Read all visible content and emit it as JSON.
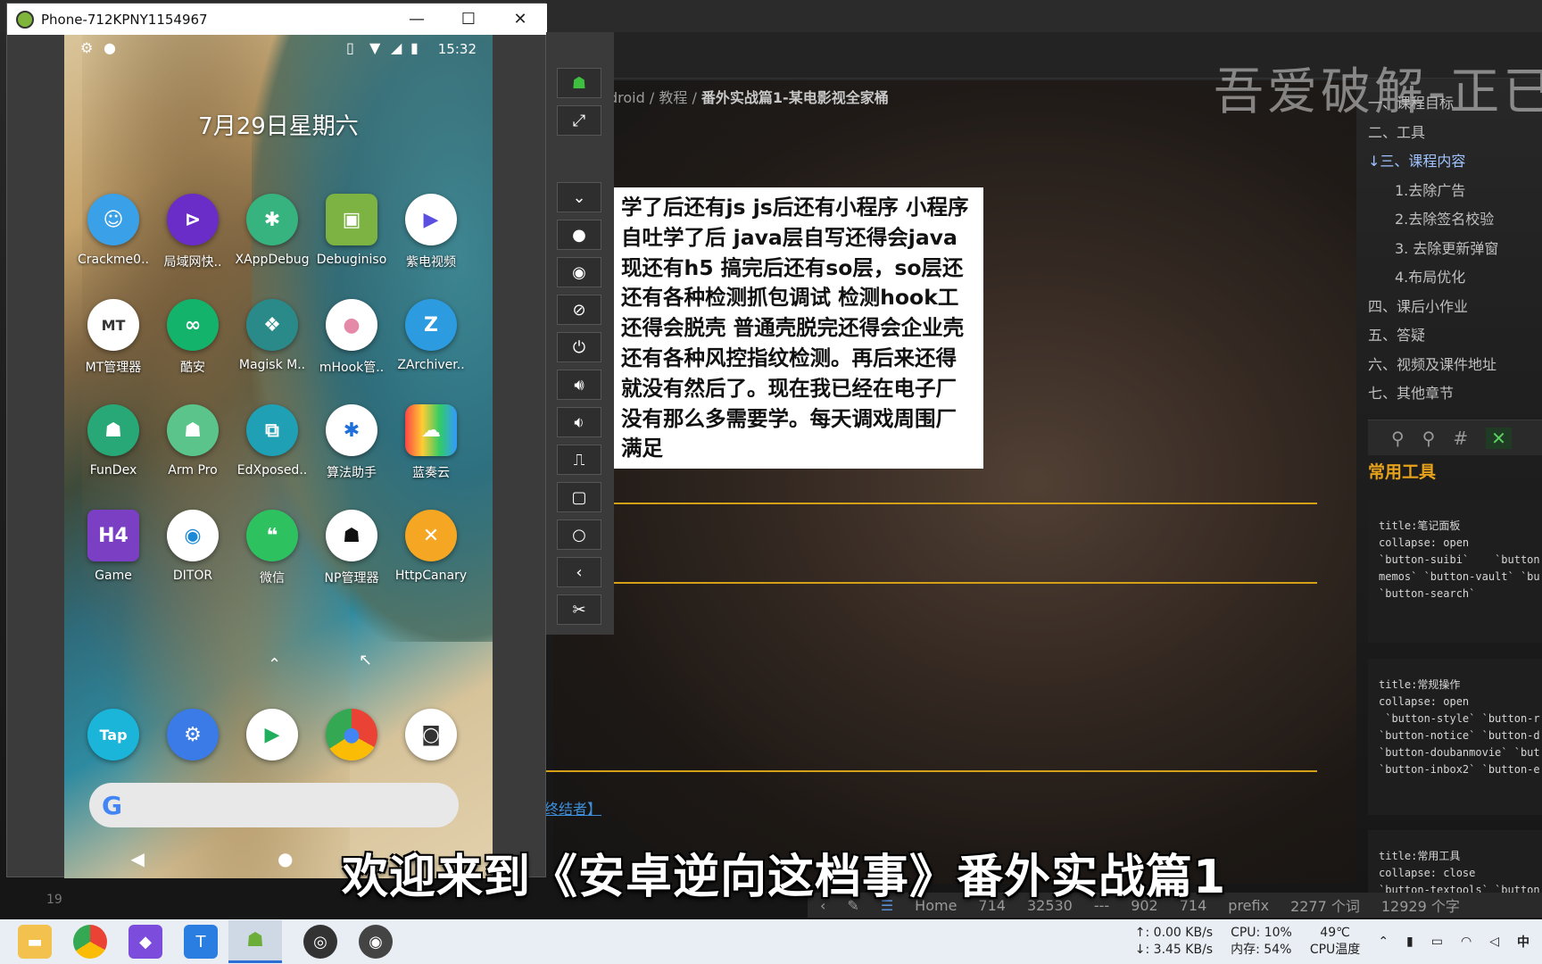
{
  "window": {
    "title": "Phone-712KPNY1154967"
  },
  "phone": {
    "time": "15:32",
    "date": "7月29日星期六",
    "apps_row1": [
      "Crackme0..",
      "局域网快..",
      "XAppDebug",
      "Debuginiso",
      "紫电视频"
    ],
    "apps_row2": [
      "MT管理器",
      "酷安",
      "Magisk M..",
      "mHook管..",
      "ZArchiver.."
    ],
    "apps_row3": [
      "FunDex",
      "Arm Pro",
      "EdXposed..",
      "算法助手",
      "蓝奏云"
    ],
    "apps_row4": [
      "Game",
      "DITOR",
      "微信",
      "NP管理器",
      "HttpCanary"
    ],
    "dock": [
      "tap-icon",
      "settings-icon",
      "play-store-icon",
      "chrome-icon",
      "camera-icon"
    ],
    "search_glyph": "G"
  },
  "editor": {
    "breadcrumb_1": "droid",
    "breadcrumb_2": "教程",
    "breadcrumb_current": "番外实战篇1-某电影视全家桶",
    "watermark": "吾爱破解-正已",
    "note_lines": [
      "学了后还有js js后还有小程序 小程序",
      "自吐学了后 java层自写还得会java",
      "现还有h5 搞完后还有so层，so层还",
      "还有各种检测抓包调试 检测hook工",
      "还得会脱壳 普通壳脱完还得会企业壳",
      "还有各种风控指纹检测。再后来还得",
      "就没有然后了。现在我已经在电子厂",
      "没有那么多需要学。每天调戏周围厂",
      "满足"
    ],
    "link_text": "终结者】",
    "line_number": "19",
    "subtitle": "欢迎来到《安卓逆向这档事》番外实战篇1"
  },
  "toc": [
    {
      "label": "一、课程目标",
      "level": 0
    },
    {
      "label": "二、工具",
      "level": 0
    },
    {
      "label": "三、课程内容",
      "level": 0,
      "current": true
    },
    {
      "label": "1.去除广告",
      "level": 1
    },
    {
      "label": "2.去除签名校验",
      "level": 1
    },
    {
      "label": "3. 去除更新弹窗",
      "level": 1
    },
    {
      "label": "4.布局优化",
      "level": 1
    },
    {
      "label": "四、课后小作业",
      "level": 0
    },
    {
      "label": "五、答疑",
      "level": 0
    },
    {
      "label": "六、视频及课件地址",
      "level": 0
    },
    {
      "label": "七、其他章节",
      "level": 0
    }
  ],
  "toc_labels": [
    "一、课程目标",
    "二、工具",
    "↓三、课程内容",
    "1.去除广告",
    "2.去除签名校验",
    "3. 去除更新弹窗",
    "4.布局优化",
    "四、课后小作业",
    "五、答疑",
    "六、视频及课件地址",
    "七、其他章节"
  ],
  "right_panel": {
    "section_title": "常用工具",
    "code1": "title:笔记面板\ncollapse: open\n`button-suibi`    `button\nmemos` `button-vault` `bu\n`button-search`",
    "code2": "title:常规操作\ncollapse: open\n `button-style` `button-r\n`button-notice` `button-d\n`button-doubanmovie` `but\n`button-inbox2` `button-e",
    "code3": "title:常用工具\ncollapse: close\n`button-textools` `button"
  },
  "statusline": {
    "home": "Home",
    "v1": "714",
    "v2": "32530",
    "v3": "---",
    "v4": "902",
    "v5": "714",
    "prefix": "prefix",
    "words": "2277 个词",
    "chars": "12929 个字"
  },
  "taskbar": {
    "upload": "↑: 0.00 KB/s",
    "download": "↓: 3.45 KB/s",
    "cpu": "CPU: 10%",
    "mem": "内存: 54%",
    "temp": "49℃",
    "temp_label": "CPU温度",
    "ime": "中"
  }
}
